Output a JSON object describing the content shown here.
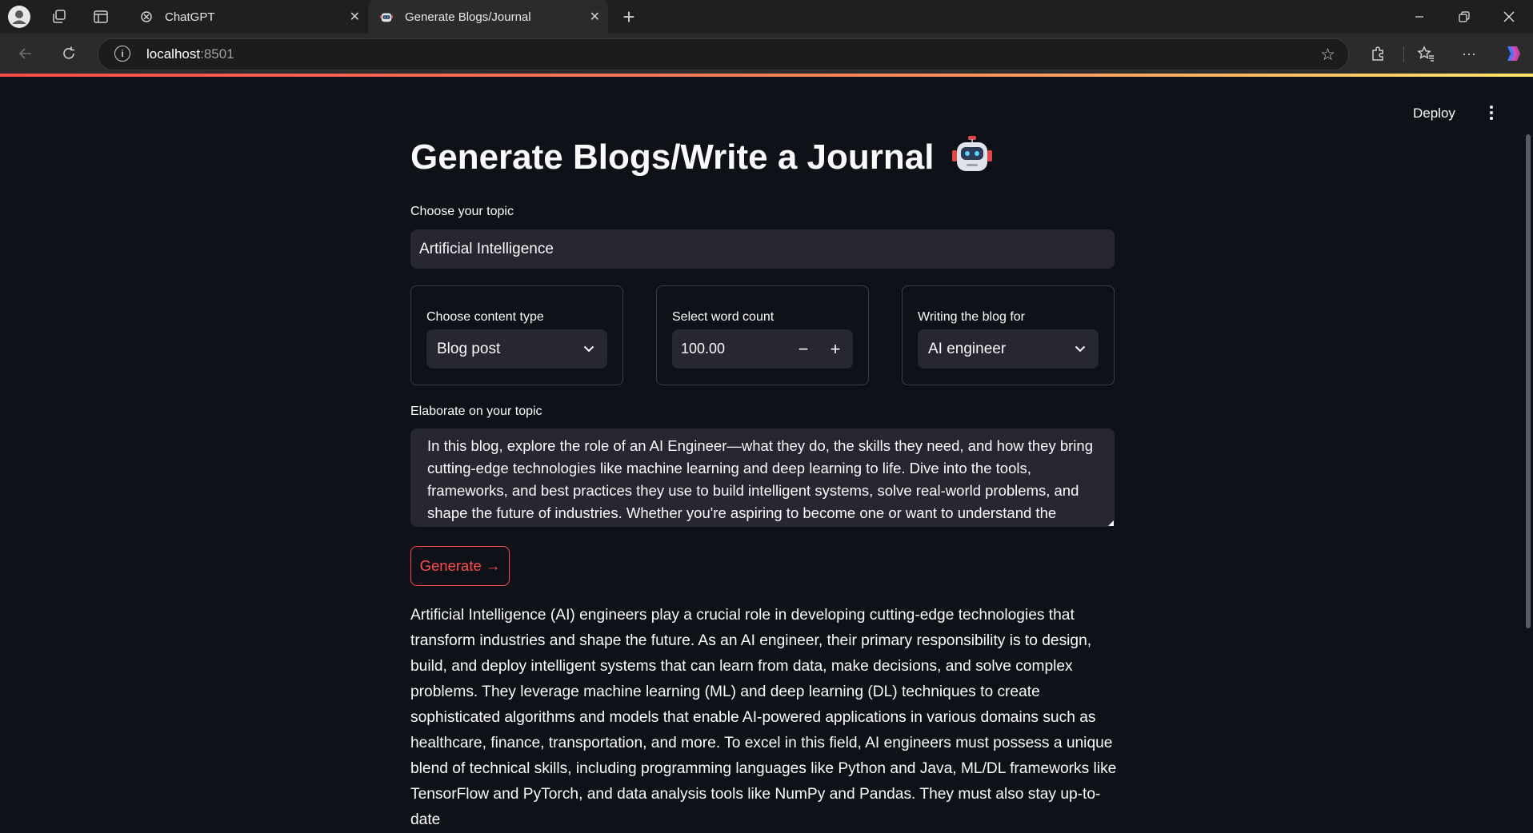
{
  "browser": {
    "tabs": [
      {
        "title": "ChatGPT",
        "active": false
      },
      {
        "title": "Generate Blogs/Journal",
        "active": true
      }
    ],
    "url_host": "localhost",
    "url_port": ":8501"
  },
  "app": {
    "deploy_label": "Deploy",
    "title": "Generate Blogs/Write a Journal",
    "topic": {
      "label": "Choose your topic",
      "value": "Artificial Intelligence"
    },
    "content_type": {
      "label": "Choose content type",
      "value": "Blog post"
    },
    "word_count": {
      "label": "Select word count",
      "value": "100.00"
    },
    "audience": {
      "label": "Writing the blog for",
      "value": "AI engineer"
    },
    "elaborate": {
      "label": "Elaborate on your topic",
      "value": "In this blog, explore the role of an AI Engineer—what they do, the skills they need, and how they bring cutting-edge technologies like machine learning and deep learning to life. Dive into the tools, frameworks, and best practices they use to build intelligent systems, solve real-world problems, and shape the future of industries. Whether you're aspiring to become one or want to understand the"
    },
    "generate_label": "Generate →",
    "output_text": "Artificial Intelligence (AI) engineers play a crucial role in developing cutting-edge technologies that transform industries and shape the future. As an AI engineer, their primary responsibility is to design, build, and deploy intelligent systems that can learn from data, make decisions, and solve complex problems. They leverage machine learning (ML) and deep learning (DL) techniques to create sophisticated algorithms and models that enable AI-powered applications in various domains such as healthcare, finance, transportation, and more. To excel in this field, AI engineers must possess a unique blend of technical skills, including programming languages like Python and Java, ML/DL frameworks like TensorFlow and PyTorch, and data analysis tools like NumPy and Pandas. They must also stay up-to-date"
  },
  "colors": {
    "accent": "#ff4b4b",
    "background": "#0e1117",
    "input_bg": "#262730"
  }
}
